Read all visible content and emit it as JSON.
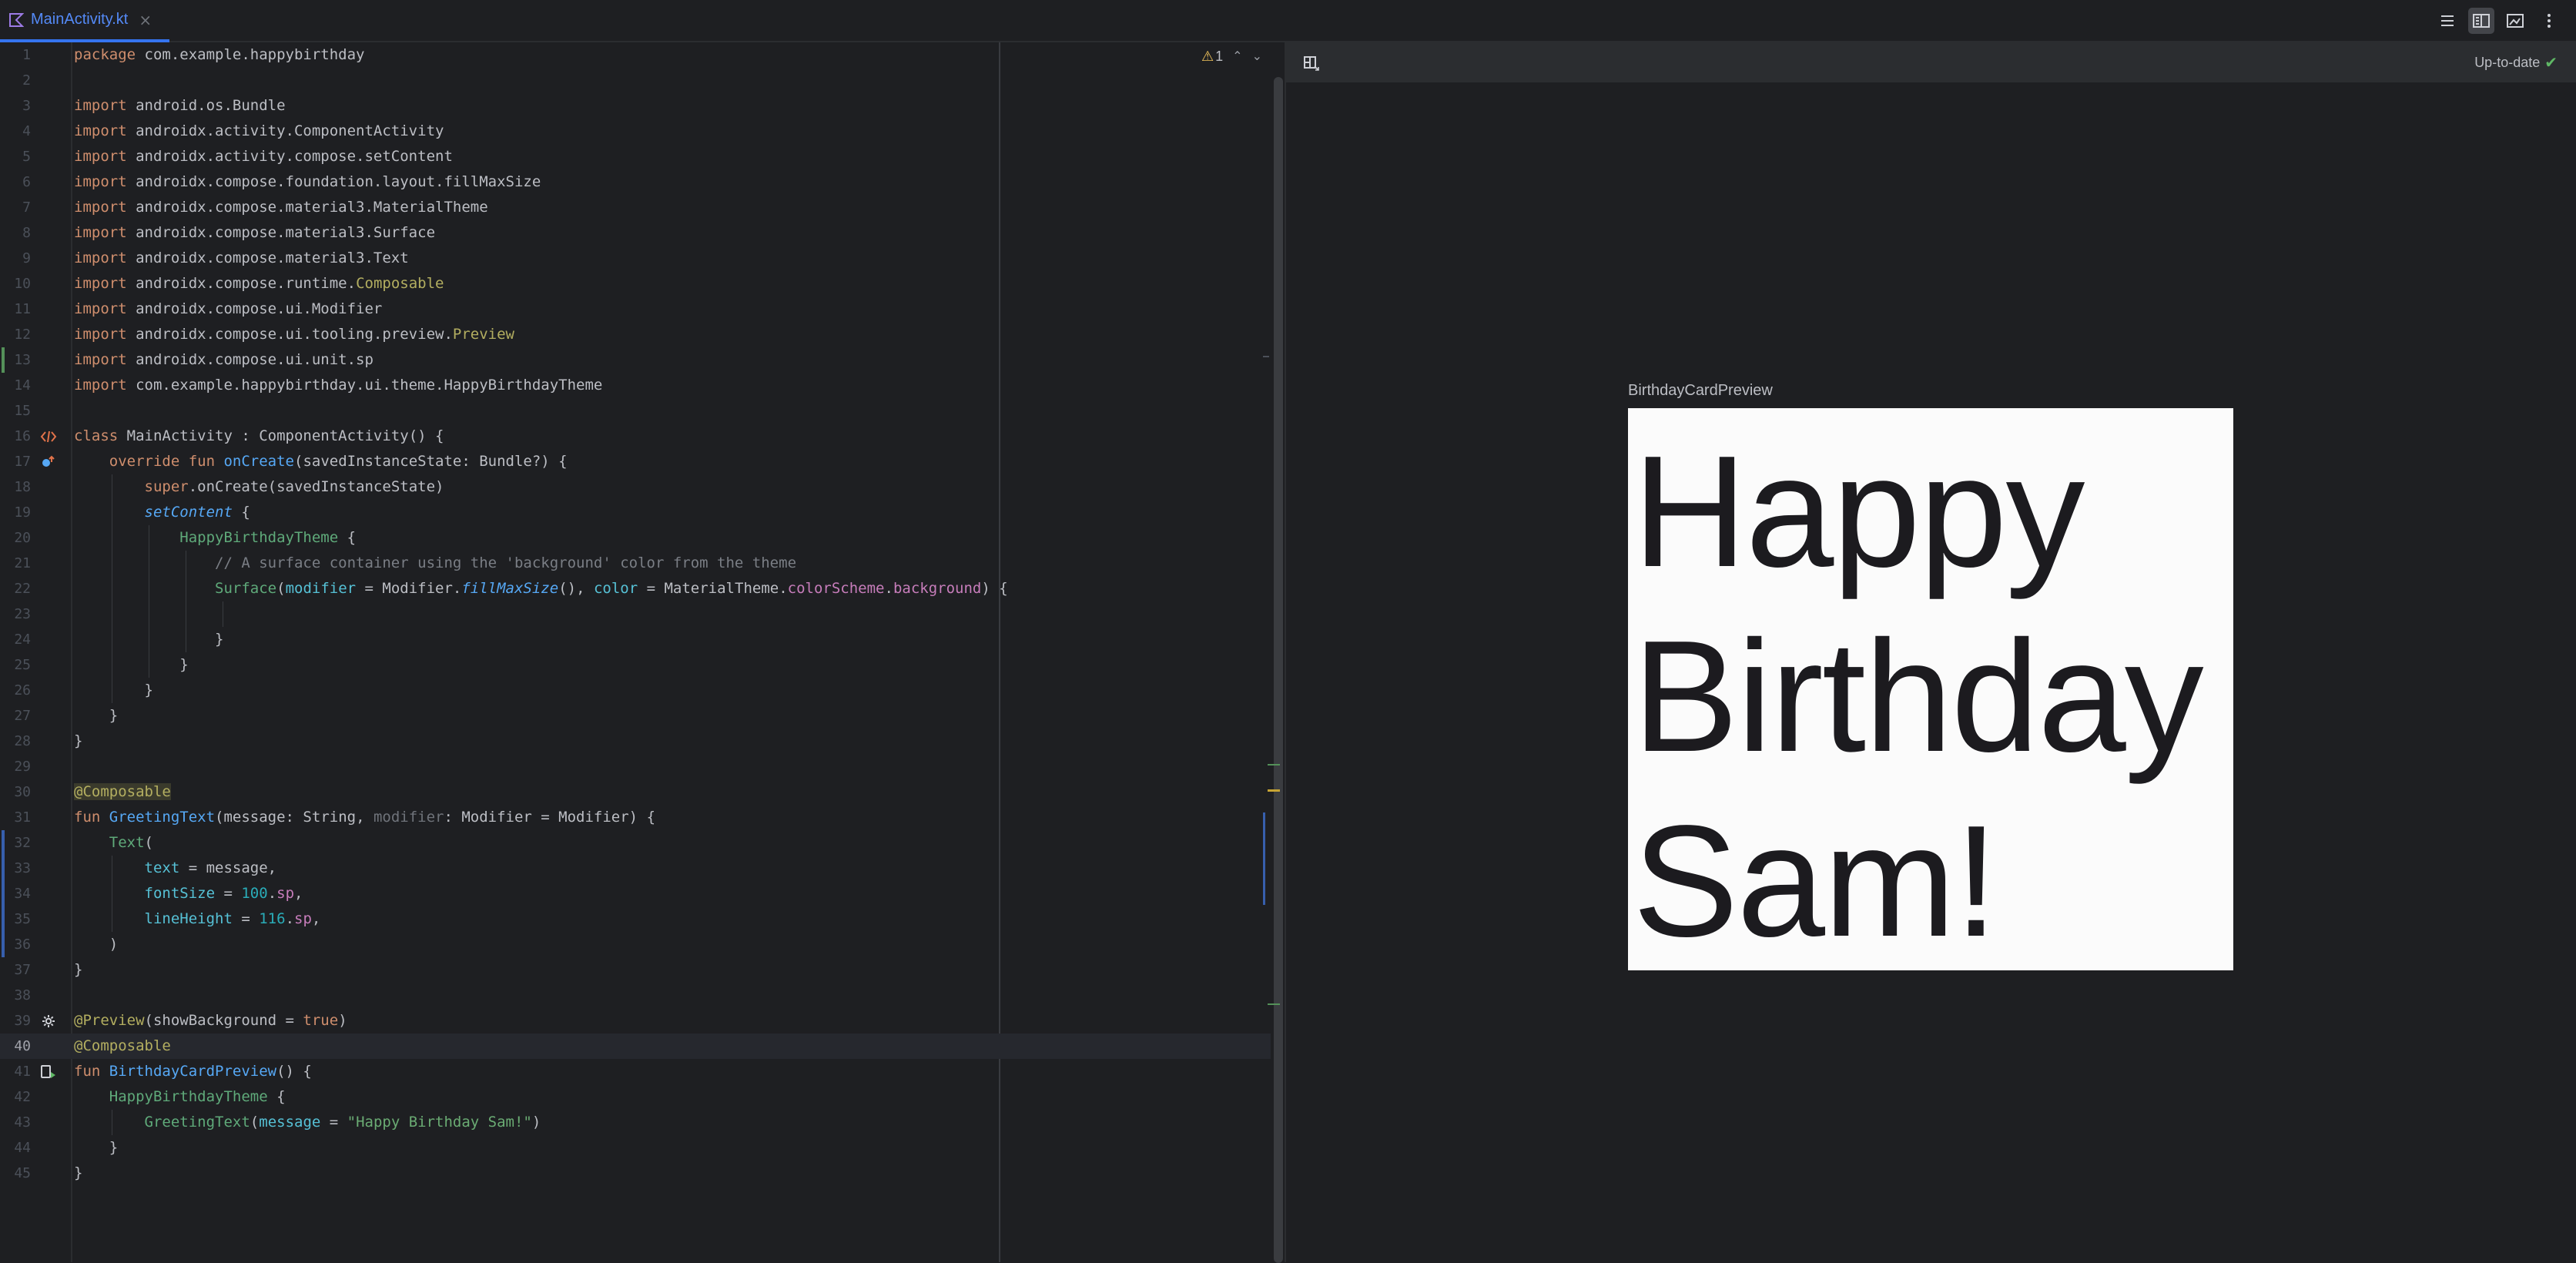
{
  "tab": {
    "label": "MainActivity.kt",
    "close": "×"
  },
  "editor": {
    "warnings": "1",
    "lines": [
      {
        "n": "1",
        "tokens": [
          [
            "kw",
            "package "
          ],
          [
            "",
            "com.example.happybirthday"
          ]
        ]
      },
      {
        "n": "2",
        "tokens": []
      },
      {
        "n": "3",
        "tokens": [
          [
            "kw",
            "import "
          ],
          [
            "",
            "android.os.Bundle"
          ]
        ]
      },
      {
        "n": "4",
        "tokens": [
          [
            "kw",
            "import "
          ],
          [
            "",
            "androidx.activity.ComponentActivity"
          ]
        ]
      },
      {
        "n": "5",
        "tokens": [
          [
            "kw",
            "import "
          ],
          [
            "",
            "androidx.activity.compose.setContent"
          ]
        ]
      },
      {
        "n": "6",
        "tokens": [
          [
            "kw",
            "import "
          ],
          [
            "",
            "androidx.compose.foundation.layout.fillMaxSize"
          ]
        ]
      },
      {
        "n": "7",
        "tokens": [
          [
            "kw",
            "import "
          ],
          [
            "",
            "androidx.compose.material3.MaterialTheme"
          ]
        ]
      },
      {
        "n": "8",
        "tokens": [
          [
            "kw",
            "import "
          ],
          [
            "",
            "androidx.compose.material3.Surface"
          ]
        ]
      },
      {
        "n": "9",
        "tokens": [
          [
            "kw",
            "import "
          ],
          [
            "",
            "androidx.compose.material3.Text"
          ]
        ]
      },
      {
        "n": "10",
        "tokens": [
          [
            "kw",
            "import "
          ],
          [
            "",
            "androidx.compose.runtime."
          ],
          [
            "ann",
            "Composable"
          ]
        ]
      },
      {
        "n": "11",
        "tokens": [
          [
            "kw",
            "import "
          ],
          [
            "",
            "androidx.compose.ui.Modifier"
          ]
        ]
      },
      {
        "n": "12",
        "tokens": [
          [
            "kw",
            "import "
          ],
          [
            "",
            "androidx.compose.ui.tooling.preview."
          ],
          [
            "ann",
            "Preview"
          ]
        ]
      },
      {
        "n": "13",
        "tokens": [
          [
            "kw",
            "import "
          ],
          [
            "",
            "androidx.compose.ui.unit.sp"
          ]
        ]
      },
      {
        "n": "14",
        "tokens": [
          [
            "kw",
            "import "
          ],
          [
            "",
            "com.example.happybirthday.ui.theme.HappyBirthdayTheme"
          ]
        ]
      },
      {
        "n": "15",
        "tokens": []
      },
      {
        "n": "16",
        "tokens": [
          [
            "kw",
            "class "
          ],
          [
            "",
            "MainActivity : ComponentActivity() {"
          ]
        ]
      },
      {
        "n": "17",
        "tokens": [
          [
            "",
            "    "
          ],
          [
            "kw",
            "override fun "
          ],
          [
            "fn",
            "onCreate"
          ],
          [
            "",
            "(savedInstanceState: Bundle?) {"
          ]
        ]
      },
      {
        "n": "18",
        "tokens": [
          [
            "",
            "        "
          ],
          [
            "kw",
            "super"
          ],
          [
            "",
            ".onCreate(savedInstanceState)"
          ]
        ]
      },
      {
        "n": "19",
        "tokens": [
          [
            "",
            "        "
          ],
          [
            "fnit",
            "setContent"
          ],
          [
            "",
            " {"
          ]
        ]
      },
      {
        "n": "20",
        "tokens": [
          [
            "",
            "            "
          ],
          [
            "grn",
            "HappyBirthdayTheme"
          ],
          [
            "",
            " {"
          ]
        ]
      },
      {
        "n": "21",
        "tokens": [
          [
            "",
            "                "
          ],
          [
            "cmt",
            "// A surface container using the 'background' color from the theme"
          ]
        ]
      },
      {
        "n": "22",
        "tokens": [
          [
            "",
            "                "
          ],
          [
            "grn",
            "Surface"
          ],
          [
            "",
            "("
          ],
          [
            "param",
            "modifier"
          ],
          [
            "",
            " = Modifier."
          ],
          [
            "fnit",
            "fillMaxSize"
          ],
          [
            "",
            "(), "
          ],
          [
            "param",
            "color"
          ],
          [
            "",
            " = MaterialTheme."
          ],
          [
            "prop",
            "colorScheme"
          ],
          [
            "",
            "."
          ],
          [
            "prop",
            "background"
          ],
          [
            "",
            ") {"
          ]
        ]
      },
      {
        "n": "23",
        "tokens": []
      },
      {
        "n": "24",
        "tokens": [
          [
            "",
            "                }"
          ]
        ]
      },
      {
        "n": "25",
        "tokens": [
          [
            "",
            "            }"
          ]
        ]
      },
      {
        "n": "26",
        "tokens": [
          [
            "",
            "        }"
          ]
        ]
      },
      {
        "n": "27",
        "tokens": [
          [
            "",
            "    }"
          ]
        ]
      },
      {
        "n": "28",
        "tokens": [
          [
            "",
            "}"
          ]
        ]
      },
      {
        "n": "29",
        "tokens": []
      },
      {
        "n": "30",
        "tokens": [
          [
            "ann-bg",
            "@Composable"
          ]
        ]
      },
      {
        "n": "31",
        "tokens": [
          [
            "kw",
            "fun "
          ],
          [
            "fn",
            "GreetingText"
          ],
          [
            "",
            "(message: String, "
          ],
          [
            "dim",
            "modifier"
          ],
          [
            "",
            ": Modifier = Modifier) {"
          ]
        ]
      },
      {
        "n": "32",
        "tokens": [
          [
            "",
            "    "
          ],
          [
            "grn",
            "Text"
          ],
          [
            "",
            "("
          ]
        ]
      },
      {
        "n": "33",
        "tokens": [
          [
            "",
            "        "
          ],
          [
            "param",
            "text"
          ],
          [
            "",
            " = message,"
          ]
        ]
      },
      {
        "n": "34",
        "tokens": [
          [
            "",
            "        "
          ],
          [
            "param",
            "fontSize"
          ],
          [
            "",
            " = "
          ],
          [
            "num",
            "100"
          ],
          [
            "",
            "."
          ],
          [
            "hl-purple",
            "sp"
          ],
          [
            "",
            ","
          ]
        ]
      },
      {
        "n": "35",
        "tokens": [
          [
            "",
            "        "
          ],
          [
            "param",
            "lineHeight"
          ],
          [
            "",
            " = "
          ],
          [
            "num",
            "116"
          ],
          [
            "",
            "."
          ],
          [
            "hl-purple",
            "sp"
          ],
          [
            "",
            ","
          ]
        ]
      },
      {
        "n": "36",
        "tokens": [
          [
            "",
            "    )"
          ]
        ]
      },
      {
        "n": "37",
        "tokens": [
          [
            "",
            "}"
          ]
        ]
      },
      {
        "n": "38",
        "tokens": []
      },
      {
        "n": "39",
        "tokens": [
          [
            "ann",
            "@Preview"
          ],
          [
            "",
            "(showBackground = "
          ],
          [
            "kw",
            "true"
          ],
          [
            "",
            ")"
          ]
        ]
      },
      {
        "n": "40",
        "tokens": [
          [
            "ann",
            "@Composable"
          ]
        ]
      },
      {
        "n": "41",
        "tokens": [
          [
            "kw",
            "fun "
          ],
          [
            "fn",
            "BirthdayCardPreview"
          ],
          [
            "",
            "() {"
          ]
        ]
      },
      {
        "n": "42",
        "tokens": [
          [
            "",
            "    "
          ],
          [
            "grn",
            "HappyBirthdayTheme"
          ],
          [
            "",
            " {"
          ]
        ]
      },
      {
        "n": "43",
        "tokens": [
          [
            "",
            "        "
          ],
          [
            "grn",
            "GreetingText"
          ],
          [
            "",
            "("
          ],
          [
            "param",
            "message"
          ],
          [
            "",
            " = "
          ],
          [
            "str",
            "\"Happy Birthday Sam!\""
          ],
          [
            "",
            ")"
          ]
        ]
      },
      {
        "n": "44",
        "tokens": [
          [
            "",
            "    }"
          ]
        ]
      },
      {
        "n": "45",
        "tokens": [
          [
            "",
            "}"
          ]
        ]
      }
    ]
  },
  "preview": {
    "status": "Up-to-date",
    "card_title": "BirthdayCardPreview",
    "card_lines": [
      "Happy",
      "Birthday",
      "Sam!"
    ]
  }
}
